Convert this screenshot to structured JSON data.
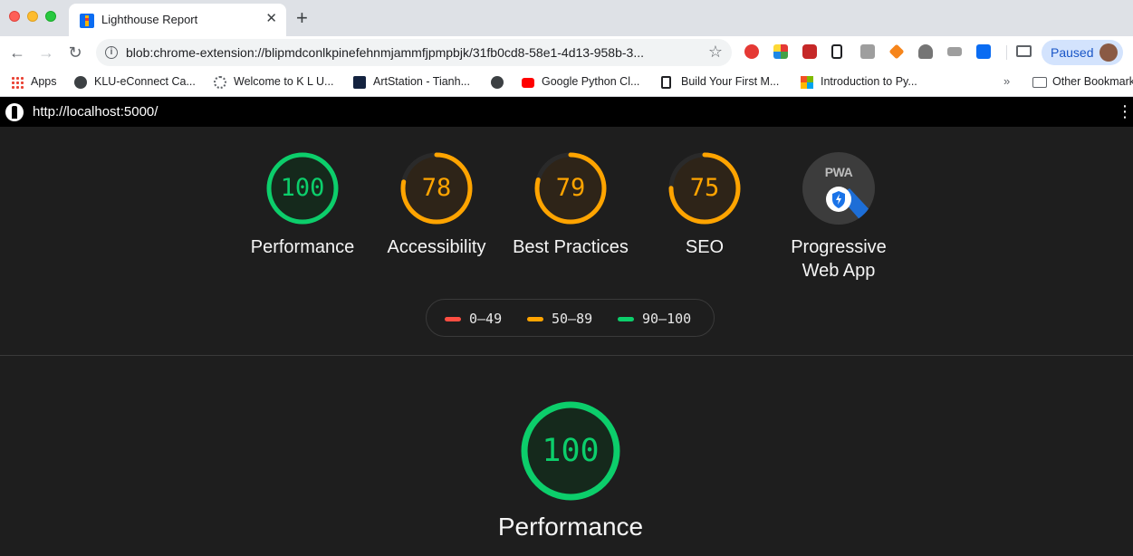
{
  "browser": {
    "tab_title": "Lighthouse Report",
    "tab_close": "✕",
    "new_tab": "+",
    "back": "←",
    "forward": "→",
    "reload": "↻",
    "url": "blob:chrome-extension://blipmdconlkpinefehnmjammfjpmpbjk/31fb0cd8-58e1-4d13-958b-3...",
    "star": "☆",
    "profile_label": "Paused",
    "menu": "⋮"
  },
  "bookmarks": {
    "items": [
      {
        "label": "Apps"
      },
      {
        "label": "KLU-eConnect Ca..."
      },
      {
        "label": "Welcome to K L U..."
      },
      {
        "label": "ArtStation - Tianh..."
      },
      {
        "label": ""
      },
      {
        "label": "Google Python Cl..."
      },
      {
        "label": "Build Your First M..."
      },
      {
        "label": "Introduction to Py..."
      }
    ],
    "more": "»",
    "other": "Other Bookmarks"
  },
  "lighthouse": {
    "url": "http://localhost:5000/",
    "menu": "⋮",
    "categories": [
      {
        "label": "Performance",
        "score": "100",
        "fraction": 1.0,
        "color": "#0cce6b"
      },
      {
        "label": "Accessibility",
        "score": "78",
        "fraction": 0.78,
        "color": "#ffa400"
      },
      {
        "label": "Best Practices",
        "score": "79",
        "fraction": 0.79,
        "color": "#ffa400"
      },
      {
        "label": "SEO",
        "score": "75",
        "fraction": 0.75,
        "color": "#ffa400"
      }
    ],
    "pwa": {
      "badge_text": "PWA",
      "label_line1": "Progressive",
      "label_line2": "Web App"
    },
    "legend": [
      {
        "range": "0–49",
        "color": "#ff4e42"
      },
      {
        "range": "50–89",
        "color": "#ffa400"
      },
      {
        "range": "90–100",
        "color": "#0cce6b"
      }
    ],
    "detail": {
      "score": "100",
      "fraction": 1.0,
      "label": "Performance",
      "color": "#0cce6b"
    }
  }
}
